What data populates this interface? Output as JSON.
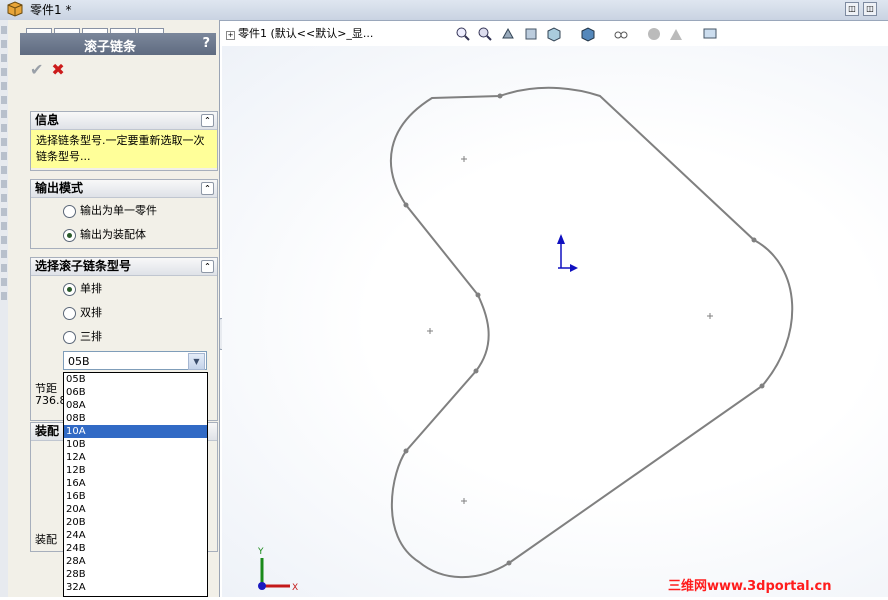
{
  "window": {
    "title": "零件1 *"
  },
  "panel": {
    "title": "滚子链条",
    "help": "?",
    "info": {
      "header": "信息",
      "text": "选择链条型号.一定要重新选取一次链条型号..."
    },
    "output": {
      "header": "输出模式",
      "options": [
        "输出为单一零件",
        "输出为装配体"
      ],
      "selected": 1
    },
    "chain_type": {
      "header": "选择滚子链条型号",
      "options": [
        "单排",
        "双排",
        "三排"
      ],
      "selected": 0
    },
    "model_select": {
      "value": "05B",
      "options": [
        "05B",
        "06B",
        "08A",
        "08B",
        "10A",
        "10B",
        "12A",
        "12B",
        "16A",
        "16B",
        "20A",
        "20B",
        "24A",
        "24B",
        "28A",
        "28B",
        "32A"
      ],
      "highlighted": "10A"
    },
    "pitch_label": "节距",
    "pitch_value": "736.8",
    "assembly_header": "装配",
    "assembly_text": "装配"
  },
  "graphics": {
    "tree_text": "零件1  (默认<<默认>_显..."
  },
  "watermark": "三维网www.3dportal.cn",
  "colors": {
    "accent": "#316ac5",
    "info_bg": "#ffff99",
    "sketch": "#808080",
    "watermark": "#ff1c1c"
  }
}
